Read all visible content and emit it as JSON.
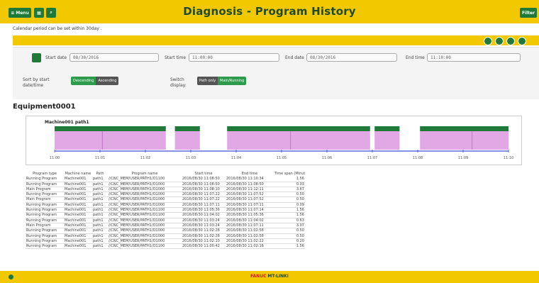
{
  "header": {
    "menu_label": "Menu",
    "title": "Diagnosis - Program History",
    "filter_label": "Filter"
  },
  "note": "Calendar period can be set within 30day .",
  "colors": {
    "accent": "#f2c800",
    "green": "#1f7a3a",
    "bar_green": "#1f7a3a",
    "bar_pink": "#e2a8e6"
  },
  "filters": {
    "start_date_label": "Start date",
    "start_date": "08/30/2016",
    "start_time_label": "Start time",
    "start_time": "11:00:00",
    "end_date_label": "End date",
    "end_date": "08/30/2016",
    "end_time_label": "End time",
    "end_time": "11:10:00",
    "sort_label_1": "Sort by start",
    "sort_label_2": "date/time",
    "sort_desc": "Descending",
    "sort_asc": "Ascending",
    "switch_label_1": "Switch",
    "switch_label_2": "display:",
    "switch_path": "Path only",
    "switch_main": "Main/Running"
  },
  "equipment": {
    "title": "Equipment0001",
    "machine_label": "Machine001 path1",
    "axis_ticks": [
      "11:00",
      "11:01",
      "11:02",
      "11:03",
      "11:04",
      "11:05",
      "11:06",
      "11:07",
      "11:08",
      "11:09",
      "11:10"
    ],
    "bars": [
      {
        "start": 0.0,
        "end": 2.45
      },
      {
        "start": 2.65,
        "end": 3.2
      },
      {
        "start": 3.8,
        "end": 6.95
      },
      {
        "start": 7.05,
        "end": 7.6
      },
      {
        "start": 8.05,
        "end": 10.0
      }
    ],
    "subdivisions": [
      1.05,
      5.2,
      9.2
    ]
  },
  "table": {
    "headers": [
      "Program type",
      "Machine name",
      "Path",
      "Program name",
      "Start time",
      "End time",
      "Time span (Minutes)"
    ],
    "rows": [
      [
        "Running Program",
        "Machine001",
        "path1",
        "//CNC_MEM/USER/PATH1/O1100",
        "2016/08/30 11:08:50",
        "2016/08/30 11:10:34",
        "1.56"
      ],
      [
        "Running Program",
        "Machine001",
        "path1",
        "//CNC_MEM/USER/PATH1/O1000",
        "2016/08/30 11:08:50",
        "2016/08/30 11:08:50",
        "0.03"
      ],
      [
        "Main Program",
        "Machine001",
        "path1",
        "//CNC_MEM/USER/PATH1/O1000",
        "2016/08/30 11:08:10",
        "2016/08/30 11:12:11",
        "3.67"
      ],
      [
        "Running Program",
        "Machine001",
        "path1",
        "//CNC_MEM/USER/PATH1/O1000",
        "2016/08/30 11:07:22",
        "2016/08/30 11:07:52",
        "0.50"
      ],
      [
        "Main Program",
        "Machine001",
        "path1",
        "//CNC_MEM/USER/PATH1/O1000",
        "2016/08/30 11:07:22",
        "2016/08/30 11:07:52",
        "0.50"
      ],
      [
        "Running Program",
        "Machine001",
        "path1",
        "//CNC_MEM/USER/PATH1/O1000",
        "2016/08/30 11:07:11",
        "2016/08/30 11:07:11",
        "0.09"
      ],
      [
        "Running Program",
        "Machine001",
        "path1",
        "//CNC_MEM/USER/PATH1/O1100",
        "2016/08/30 11:05:36",
        "2016/08/30 11:07:14",
        "1.56"
      ],
      [
        "Running Program",
        "Machine001",
        "path1",
        "//CNC_MEM/USER/PATH1/O1100",
        "2016/08/30 11:04:02",
        "2016/08/30 11:05:36",
        "1.56"
      ],
      [
        "Running Program",
        "Machine001",
        "path1",
        "//CNC_MEM/USER/PATH1/O1000",
        "2016/08/30 11:03:24",
        "2016/08/30 11:04:02",
        "0.63"
      ],
      [
        "Main Program",
        "Machine001",
        "path1",
        "//CNC_MEM/USER/PATH1/O1000",
        "2016/08/30 11:03:24",
        "2016/08/30 11:07:11",
        "3.07"
      ],
      [
        "Running Program",
        "Machine001",
        "path1",
        "//CNC_MEM/USER/PATH1/O1000",
        "2016/08/30 11:02:28",
        "2016/08/30 11:02:58",
        "0.50"
      ],
      [
        "Running Program",
        "Machine001",
        "path1",
        "//CNC_MEM/USER/PATH1/O1000",
        "2016/08/30 11:02:28",
        "2016/08/30 11:02:58",
        "0.50"
      ],
      [
        "Running Program",
        "Machine001",
        "path1",
        "//CNC_MEM/USER/PATH1/O1000",
        "2016/08/30 11:02:10",
        "2016/08/30 11:02:22",
        "0.20"
      ],
      [
        "Running Program",
        "Machine001",
        "path1",
        "//CNC_MEM/USER/PATH1/O1100",
        "2016/08/30 11:00:42",
        "2016/08/30 11:02:16",
        "1.56"
      ]
    ]
  },
  "footer": {
    "brand_red": "FANUC",
    "brand_rest": "MT-LINKi"
  }
}
